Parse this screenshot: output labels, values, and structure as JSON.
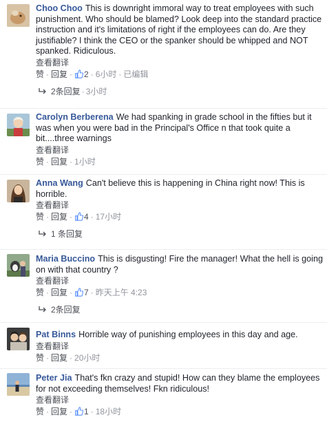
{
  "comments": [
    {
      "author": "Choo Choo",
      "text": "This is downright immoral way to treat employees with such punishment. Who should be blamed? Look deep into the standard practice instruction and it's limitations of right if the employees can do. Are they justifiable? I think the CEO or the spanker should be whipped and NOT spanked. Ridiculous.",
      "translate": "查看翻译",
      "like": "赞",
      "reply": "回复",
      "likes": "2",
      "time": "6小时",
      "edited": "已编辑",
      "replies": "2条回复",
      "replies_time": "3小时"
    },
    {
      "author": "Carolyn Berberena",
      "text": "We had spanking in grade school in the fifties but it was when you were bad in the Principal's Office n that took quite a bit....three warnings",
      "translate": "查看翻译",
      "like": "赞",
      "reply": "回复",
      "time": "1小时"
    },
    {
      "author": "Anna Wang",
      "text": "Can't believe this is happening in China right now! This is horrible.",
      "translate": "查看翻译",
      "like": "赞",
      "reply": "回复",
      "likes": "4",
      "time": "17小时",
      "replies": "1 条回复"
    },
    {
      "author": "Maria Buccino",
      "text": "This is disgusting! Fire the manager! What the hell is going on with that country ?",
      "translate": "查看翻译",
      "like": "赞",
      "reply": "回复",
      "likes": "7",
      "time": "昨天上午 4:23",
      "replies": "2条回复"
    },
    {
      "author": "Pat Binns",
      "text": "Horrible way of punishing employees in this day and age.",
      "translate": "查看翻译",
      "like": "赞",
      "reply": "回复",
      "time": "20小时"
    },
    {
      "author": "Peter Jia",
      "text": "That's fkn crazy and stupid! How can they blame the employees for not exceeding themselves! Fkn ridiculous!",
      "translate": "查看翻译",
      "like": "赞",
      "reply": "回复",
      "likes": "1",
      "time": "18小时"
    }
  ],
  "icons": {
    "like_count": "thumbs-up-icon",
    "replies": "reply-arrow-icon"
  },
  "colors": {
    "author": "#365899",
    "meta": "#90949c",
    "like_badge": "#5890ff"
  }
}
